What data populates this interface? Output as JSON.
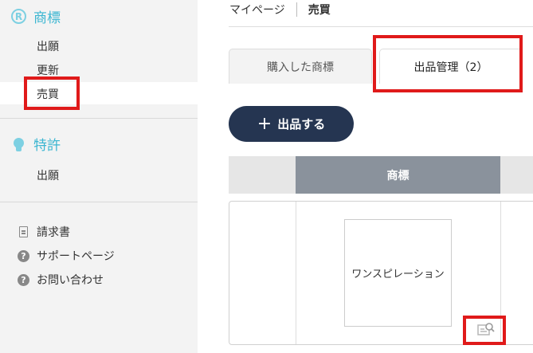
{
  "sidebar": {
    "trademark": {
      "label": "商標",
      "icon": "registered-icon",
      "items": [
        "出願",
        "更新",
        "売買"
      ]
    },
    "patent": {
      "label": "特許",
      "icon": "lightbulb-icon",
      "items": [
        "出願"
      ]
    },
    "utilities": [
      {
        "label": "請求書",
        "icon": "invoice-icon"
      },
      {
        "label": "サポートページ",
        "icon": "help-icon"
      },
      {
        "label": "お問い合わせ",
        "icon": "help-icon"
      }
    ]
  },
  "breadcrumb": {
    "home": "マイページ",
    "current": "売買"
  },
  "tabs": {
    "purchased": "購入した商標",
    "listings": "出品管理（2）"
  },
  "actions": {
    "list_button": "出品する",
    "plus": "+"
  },
  "table": {
    "header_mark": "商標",
    "rows": [
      {
        "mark_text": "ワンスピレーション"
      }
    ]
  },
  "colors": {
    "accent": "#3bb6d1",
    "primary_button": "#253551",
    "highlight": "#e01a1a",
    "header": "#8a929c"
  }
}
